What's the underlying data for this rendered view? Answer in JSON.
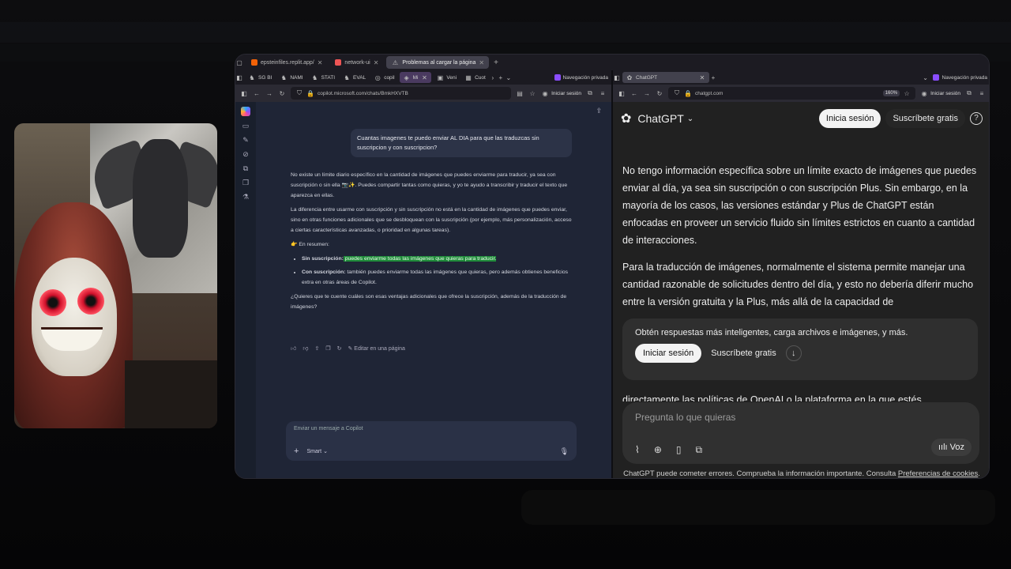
{
  "top_tabs": [
    {
      "label": "epsteinfiles.replit.app/",
      "active": false
    },
    {
      "label": "network-ui",
      "active": false
    },
    {
      "label": "Problemas al cargar la página",
      "active": true
    }
  ],
  "left": {
    "tabs": [
      "SG BI",
      "NAMI",
      "STATI",
      "EVAL",
      "copil",
      "Mi",
      "Veni",
      "Cuot"
    ],
    "private": "Navegación privada",
    "url": "copilot.microsoft.com/chats/BmkHXVTB",
    "session": "Iniciar sesión",
    "user_message": "Cuantas imagenes te puedo enviar AL DIA para que las traduzcas sin suscripcion y con suscripcion?",
    "answer_p1": "No existe un límite diario específico en la cantidad de imágenes que puedes enviarme para traducir, ya sea con suscripción o sin ella 📷✨. Puedes compartir tantas como quieras, y yo te ayudo a transcribir y traducir el texto que aparezca en ellas.",
    "answer_p2": "La diferencia entre usarme con suscripción y sin suscripción no está en la cantidad de imágenes que puedes enviar, sino en otras funciones adicionales que se desbloquean con la suscripción (por ejemplo, más personalización, acceso a ciertas características avanzadas, o prioridad en algunas tareas).",
    "summary": "👉 En resumen:",
    "b1_label": "Sin suscripción:",
    "b1_text": " puedes enviarme todas las imágenes que quieras para traducir.",
    "b2_label": "Con suscripción:",
    "b2_text": " también puedes enviarme todas las imágenes que quieras, pero además obtienes beneficios extra en otras áreas de Copilot.",
    "question": "¿Quieres que te cuente cuáles son esas ventajas adicionales que ofrece la suscripción, además de la traducción de imágenes?",
    "edit_page": "Editar en una página",
    "composer_placeholder": "Enviar un mensaje a Copilot",
    "mode": "Smart"
  },
  "right": {
    "tab": "ChatGPT",
    "private": "Navegación privada",
    "url": "chatgpt.com",
    "zoom": "160%",
    "session": "Iniciar sesión",
    "brand": "ChatGPT",
    "login": "Inicia sesión",
    "subscribe": "Suscríbete gratis",
    "p1": "No tengo información específica sobre un límite exacto de imágenes que puedes enviar al día, ya sea sin suscripción o con suscripción Plus. Sin embargo, en la mayoría de los casos, las versiones estándar y Plus de ChatGPT están enfocadas en proveer un servicio fluido sin límites estrictos en cuanto a cantidad de interacciones.",
    "p2": "Para la traducción de imágenes, normalmente el sistema permite manejar una cantidad razonable de solicitudes dentro del día, y esto no debería diferir mucho entre la versión gratuita y la Plus, más allá de la capacidad de",
    "card_text": "Obtén respuestas más inteligentes, carga archivos e imágenes, y más.",
    "card_login": "Iniciar sesión",
    "card_subscribe": "Suscríbete gratis",
    "cut_line": "directamente las políticas de OpenAI o la plataforma en la que estés",
    "input_placeholder": "Pregunta lo que quieras",
    "voice": "Voz",
    "disclaimer": "ChatGPT puede cometer errores. Comprueba la información importante. Consulta ",
    "disclaimer_link": "Preferencias de cookies",
    "disclaimer_end": "."
  }
}
